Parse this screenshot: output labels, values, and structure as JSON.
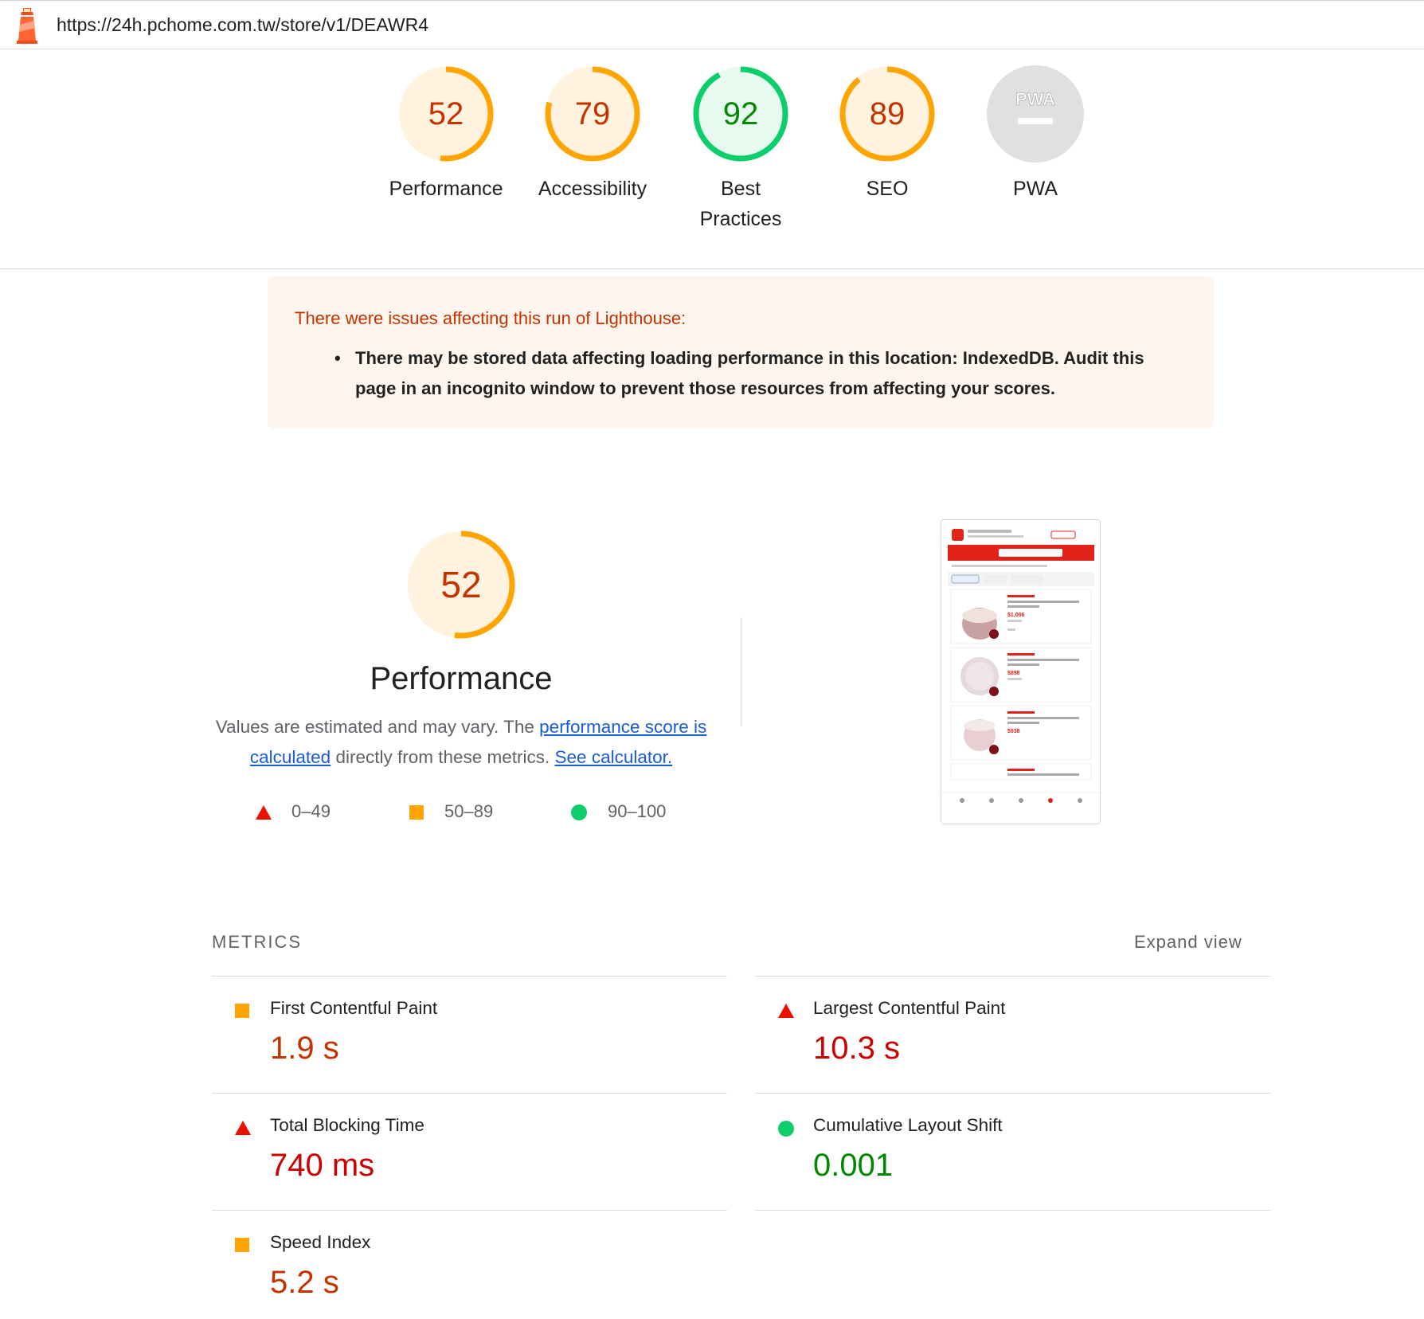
{
  "topbar": {
    "url": "https://24h.pchome.com.tw/store/v1/DEAWR4",
    "logo_icon": "lighthouse-icon"
  },
  "gauges": [
    {
      "score": "52",
      "value": 52,
      "label": "Performance",
      "rating": "average"
    },
    {
      "score": "79",
      "value": 79,
      "label": "Accessibility",
      "rating": "average"
    },
    {
      "score": "92",
      "value": 92,
      "label": "Best Practices",
      "rating": "pass"
    },
    {
      "score": "89",
      "value": 89,
      "label": "SEO",
      "rating": "average"
    },
    {
      "score": "",
      "value": null,
      "label": "PWA",
      "rating": "na",
      "badge": "PWA"
    }
  ],
  "warning": {
    "title": "There were issues affecting this run of Lighthouse:",
    "items": [
      "There may be stored data affecting loading performance in this location: IndexedDB. Audit this page in an incognito window to prevent those resources from affecting your scores."
    ]
  },
  "performance": {
    "score": "52",
    "value": 52,
    "title": "Performance",
    "desc_before": "Values are estimated and may vary. The ",
    "link1": "performance score is calculated",
    "desc_middle": " directly from these metrics. ",
    "link2": "See calculator.",
    "legend": [
      {
        "range": "0–49",
        "icon": "fail-triangle-icon"
      },
      {
        "range": "50–89",
        "icon": "average-square-icon"
      },
      {
        "range": "90–100",
        "icon": "pass-circle-icon"
      }
    ]
  },
  "metrics": {
    "heading": "METRICS",
    "expand_label": "Expand view",
    "items": [
      {
        "name": "First Contentful Paint",
        "value": "1.9 s",
        "rating": "average"
      },
      {
        "name": "Largest Contentful Paint",
        "value": "10.3 s",
        "rating": "fail"
      },
      {
        "name": "Total Blocking Time",
        "value": "740 ms",
        "rating": "fail"
      },
      {
        "name": "Cumulative Layout Shift",
        "value": "0.001",
        "rating": "pass"
      },
      {
        "name": "Speed Index",
        "value": "5.2 s",
        "rating": "average"
      }
    ]
  },
  "colors": {
    "average": "#ffa400",
    "average_text": "#c33300",
    "average_bg": "#fff3e0",
    "fail": "#eb0f00",
    "fail_text": "#cc0000",
    "pass": "#0cce6b",
    "pass_text": "#008800",
    "pass_bg": "#e6faef",
    "na_bg": "#e0e0e0",
    "link": "#1a5bd6"
  },
  "thumbnail": {
    "prices": [
      "$1,006",
      "$898",
      "$938"
    ]
  }
}
